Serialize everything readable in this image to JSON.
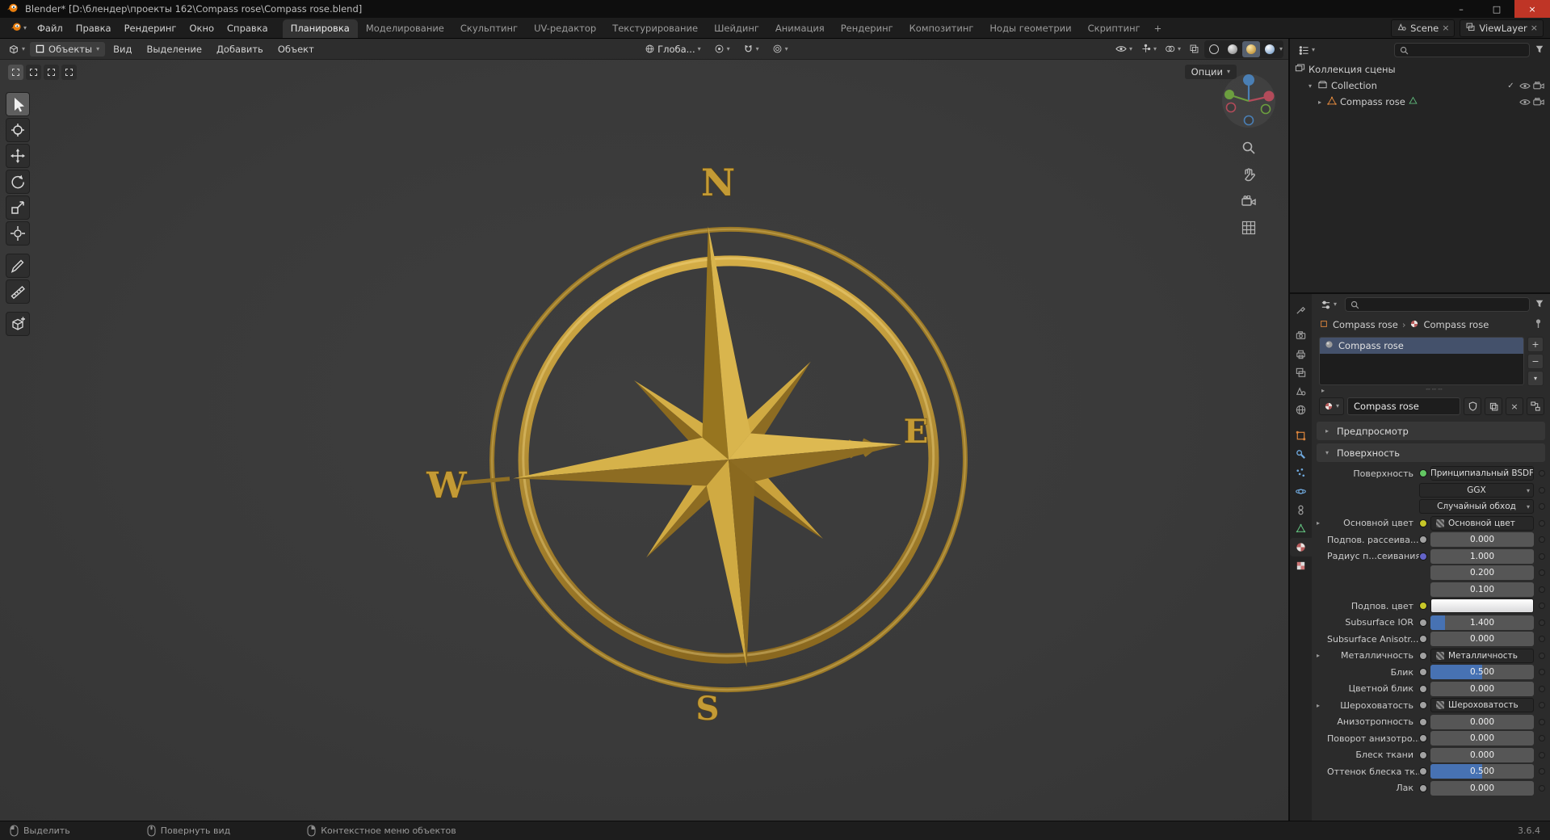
{
  "colors": {
    "accent": "#4772b3",
    "gold": "#c39a35",
    "close_red": "#bf3526",
    "object_orange": "#d8833c",
    "mesh_green": "#5fb87a",
    "viewport_bg": "#3b3b3b"
  },
  "icons": {
    "chev": "▾",
    "caret_right": "▸",
    "caret_down": "▾",
    "close": "×",
    "min": "–",
    "max": "□",
    "check": "✓",
    "plus": "+",
    "minus": "−",
    "grip": "┄┄┄",
    "sep": "›"
  },
  "titlebar": {
    "title": "Blender* [D:\\блендер\\проекты 162\\Compass rose\\Compass rose.blend]"
  },
  "topbar": {
    "menus": [
      "Файл",
      "Правка",
      "Рендеринг",
      "Окно",
      "Справка"
    ],
    "tabs": [
      "Планировка",
      "Моделирование",
      "Скульптинг",
      "UV-редактор",
      "Текстурирование",
      "Шейдинг",
      "Анимация",
      "Рендеринг",
      "Композитинг",
      "Ноды геометрии",
      "Скриптинг"
    ],
    "add_tab": "+",
    "scene": "Scene",
    "view_layer": "ViewLayer"
  },
  "viewport": {
    "header": {
      "mode": "Объекты",
      "menus": [
        "Вид",
        "Выделение",
        "Добавить",
        "Объект"
      ],
      "orientation": "Глоба..."
    },
    "tool_options": "Опции",
    "compass": {
      "north": "N",
      "east": "E",
      "south": "S",
      "west": "W"
    }
  },
  "outliner": {
    "rows": [
      {
        "label": "Коллекция сцены"
      },
      {
        "label": "Collection"
      },
      {
        "label": "Compass rose"
      }
    ]
  },
  "properties": {
    "breadcrumb": {
      "object": "Compass rose",
      "material": "Compass rose"
    },
    "slots": [
      {
        "name": "Compass rose"
      }
    ],
    "datablock_name": "Compass rose",
    "panels": {
      "preview": "Предпросмотр",
      "surface": "Поверхность"
    },
    "rows": [
      {
        "label": "Поверхность",
        "value": "Принципиальный BSDF"
      },
      {
        "label": "",
        "value": "GGX"
      },
      {
        "label": "",
        "value": "Случайный обход"
      },
      {
        "label": "Основной цвет",
        "value": "Основной цвет"
      },
      {
        "label": "Подпов. рассеива...",
        "value": "0.000",
        "fill": 0
      },
      {
        "label": "Радиус п...сеивания",
        "value": "1.000"
      },
      {
        "label": "",
        "value": "0.200"
      },
      {
        "label": "",
        "value": "0.100"
      },
      {
        "label": "Подпов. цвет",
        "value": ""
      },
      {
        "label": "Subsurface IOR",
        "value": "1.400",
        "fill": 0.14
      },
      {
        "label": "Subsurface Anisotr...",
        "value": "0.000",
        "fill": 0
      },
      {
        "label": "Металличность",
        "value": "Металличность"
      },
      {
        "label": "Блик",
        "value": "0.500",
        "fill": 0.5
      },
      {
        "label": "Цветной блик",
        "value": "0.000",
        "fill": 0
      },
      {
        "label": "Шероховатость",
        "value": "Шероховатость"
      },
      {
        "label": "Анизотропность",
        "value": "0.000",
        "fill": 0
      },
      {
        "label": "Поворот анизотро...",
        "value": "0.000",
        "fill": 0
      },
      {
        "label": "Блеск ткани",
        "value": "0.000",
        "fill": 0
      },
      {
        "label": "Оттенок блеска тк...",
        "value": "0.500",
        "fill": 0.5
      },
      {
        "label": "Лак",
        "value": "0.000",
        "fill": 0
      }
    ]
  },
  "statusbar": {
    "hints": [
      "Выделить",
      "Повернуть вид",
      "Контекстное меню объектов"
    ],
    "version": "3.6.4"
  }
}
